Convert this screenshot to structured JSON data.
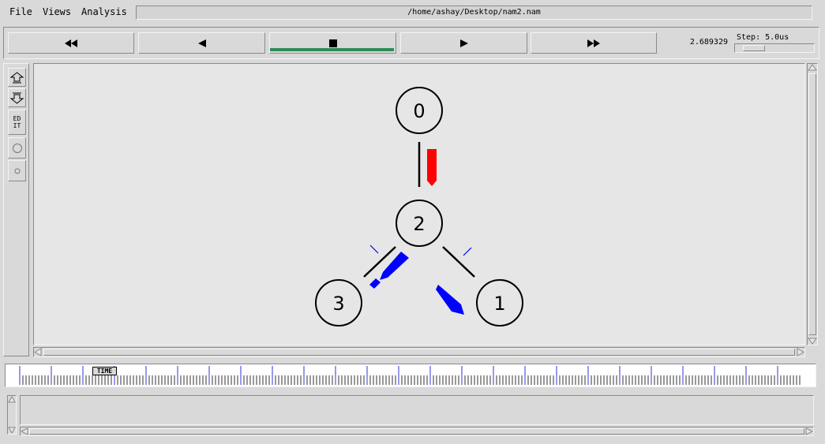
{
  "menu": {
    "file": "File",
    "views": "Views",
    "analysis": "Analysis"
  },
  "file_path": "/home/ashay/Desktop/nam2.nam",
  "controls": {
    "rewind_icon": "fast-rewind-icon",
    "back_icon": "play-backward-icon",
    "stop_icon": "stop-icon",
    "play_icon": "play-forward-icon",
    "forward_icon": "fast-forward-icon",
    "active": "stop"
  },
  "time_display": "2.689329",
  "step": {
    "label": "Step: 5.0us"
  },
  "tools": {
    "zoom_in_icon": "zoom-in-icon",
    "zoom_out_icon": "zoom-out-icon",
    "edit_label": "ED\nIT",
    "circle_icon": "circle-icon",
    "small_circle_icon": "small-circle-icon"
  },
  "network": {
    "nodes": [
      {
        "id": "0",
        "label": "0"
      },
      {
        "id": "1",
        "label": "1"
      },
      {
        "id": "2",
        "label": "2"
      },
      {
        "id": "3",
        "label": "3"
      }
    ],
    "links": [
      {
        "from": "0",
        "to": "2"
      },
      {
        "from": "2",
        "to": "1"
      },
      {
        "from": "2",
        "to": "3"
      }
    ],
    "packet_colors": {
      "red": "#ff0000",
      "blue": "#0000ff"
    }
  },
  "timeline": {
    "marker_label": "TIME"
  },
  "colors": {
    "active_indicator": "#2e8b57",
    "canvas_bg": "#e6e6e6"
  }
}
